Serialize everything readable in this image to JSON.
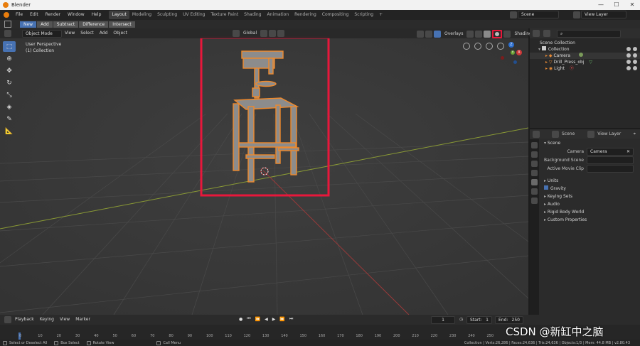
{
  "window": {
    "title": "Blender"
  },
  "menu": {
    "items": [
      "File",
      "Edit",
      "Render",
      "Window",
      "Help"
    ],
    "workspaces": [
      "Layout",
      "Modeling",
      "Sculpting",
      "UV Editing",
      "Texture Paint",
      "Shading",
      "Animation",
      "Rendering",
      "Compositing",
      "Scripting"
    ],
    "add_tab": "+",
    "scene_field": "Scene",
    "view_layer_field": "View Layer"
  },
  "tool_header": {
    "buttons": [
      "New",
      "Add",
      "Subtract",
      "Difference",
      "Intersect"
    ]
  },
  "viewport_header": {
    "mode": "Object Mode",
    "items": [
      "View",
      "Select",
      "Add",
      "Object"
    ],
    "orientation": "Global",
    "overlays": "Overlays",
    "shading": "Shading"
  },
  "viewport": {
    "perspective_label": "User Perspective",
    "collection_label": "(1) Collection",
    "gizmo": {
      "x": "X",
      "y": "Y",
      "z": "Z"
    },
    "highlight_color": "#e8173b",
    "selection_color": "#f08a2c"
  },
  "outliner": {
    "root": "Scene Collection",
    "collection": "Collection",
    "objects": [
      "Camera",
      "Drill_Press_obj",
      "Light"
    ]
  },
  "properties": {
    "tabs": [
      "Scene",
      "View Layer"
    ],
    "section_scene": "Scene",
    "camera_label": "Camera",
    "camera_value": "Camera",
    "background_scene_label": "Background Scene",
    "active_movie_clip_label": "Active Movie Clip",
    "units": "Units",
    "gravity": "Gravity",
    "keying_sets": "Keying Sets",
    "audio": "Audio",
    "rigid_body_world": "Rigid Body World",
    "custom_properties": "Custom Properties"
  },
  "timeline": {
    "menus": [
      "Playback",
      "Keying",
      "View",
      "Marker"
    ],
    "current_frame": "1",
    "start_label": "Start:",
    "start_value": "1",
    "end_label": "End:",
    "end_value": "250",
    "ticks": [
      "0",
      "10",
      "20",
      "30",
      "40",
      "50",
      "60",
      "70",
      "80",
      "90",
      "100",
      "110",
      "120",
      "130",
      "140",
      "150",
      "160",
      "170",
      "180",
      "190",
      "200",
      "210",
      "220",
      "230",
      "240",
      "250"
    ]
  },
  "statusbar": {
    "select": "Select or Deselect All",
    "box": "Box Select",
    "rotate": "Rotate View",
    "call_menu": "Call Menu",
    "stats": "Collection | Verts:26,286 | Faces:24,636 | Tris:24,636 | Objects:1/3 | Mem: 44.8 MB | v2.80.43"
  },
  "watermark": "CSDN @新缸中之脑"
}
